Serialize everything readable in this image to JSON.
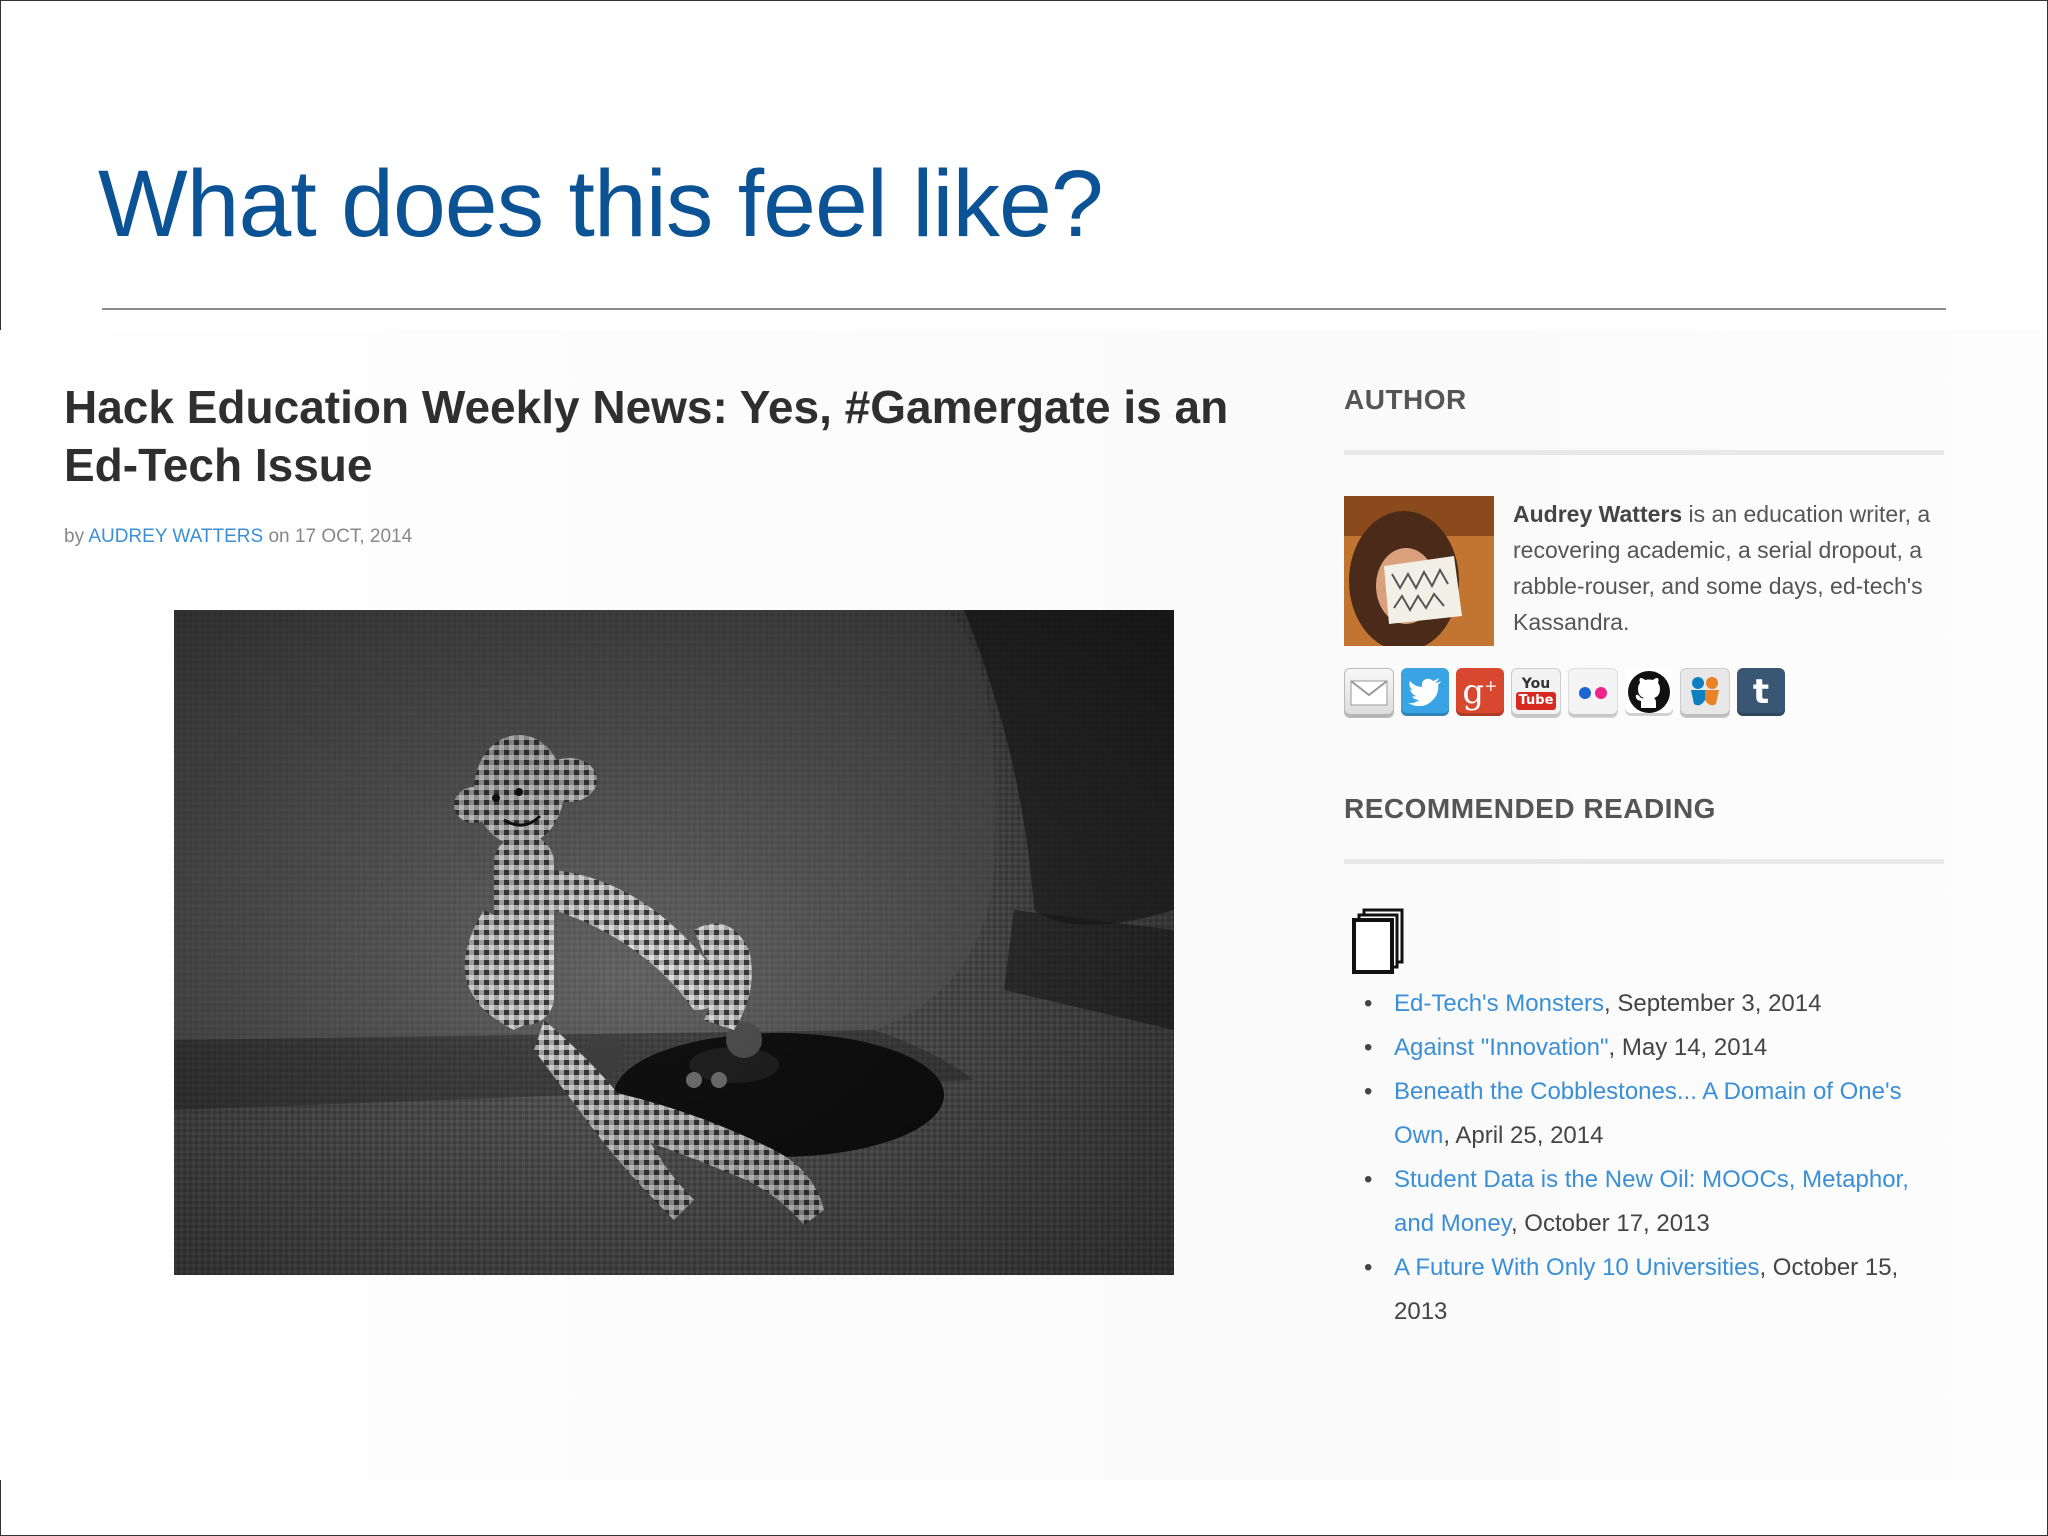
{
  "slide": {
    "title": "What does this feel like?"
  },
  "post": {
    "title": "Hack Education Weekly News: Yes, #Gamergate is an Ed-Tech Issue",
    "by_label": "by",
    "author": "AUDREY WATTERS",
    "on_label": "on",
    "date": "17 OCT, 2014",
    "hero_image": "black-and-white photo of a gingham sock monkey holding a game controller on a couch"
  },
  "sidebar": {
    "author_heading": "AUTHOR",
    "author_name": "Audrey Watters",
    "author_bio": " is an education writer, a recovering academic, a serial dropout, a rabble-rouser, and some days, ed-tech's Kassandra.",
    "social_icons": [
      "email-icon",
      "twitter-icon",
      "google-plus-icon",
      "youtube-icon",
      "flickr-icon",
      "github-icon",
      "slideshare-icon",
      "tumblr-icon"
    ],
    "reading_heading": "RECOMMENDED READING",
    "reading": [
      {
        "title": "Ed-Tech's Monsters",
        "date": ", September 3, 2014"
      },
      {
        "title": "Against \"Innovation\"",
        "date": ", May 14, 2014"
      },
      {
        "title": "Beneath the Cobblestones... A Domain of One's Own",
        "date": ", April 25, 2014"
      },
      {
        "title": "Student Data is the New Oil: MOOCs, Metaphor, and Money",
        "date": ", October 17, 2013"
      },
      {
        "title": "A Future With Only 10 Universities",
        "date": ", October 15, 2013"
      }
    ]
  },
  "colors": {
    "title_blue": "#0b5394",
    "link_blue": "#3a8fd6"
  }
}
